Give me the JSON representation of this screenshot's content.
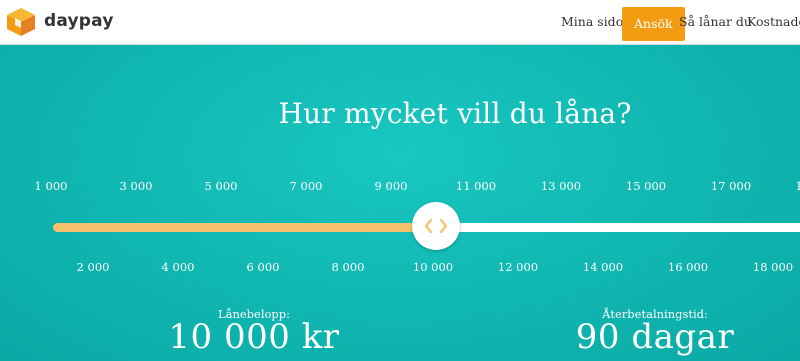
{
  "header": {
    "brand": "daypay",
    "nav": {
      "my_pages": "Mina sidor",
      "apply": "Ansök",
      "how_to_borrow": "Så lånar du",
      "costs": "Kostnader"
    },
    "cta_color": "#f39c12"
  },
  "hero": {
    "title": "Hur mycket vill du låna?",
    "background_color": "#10b6b0"
  },
  "slider": {
    "top_ticks": [
      "1 000",
      "3 000",
      "5 000",
      "7 000",
      "9 000",
      "11 000",
      "13 000",
      "15 000",
      "17 000",
      "1"
    ],
    "bottom_ticks": [
      "2 000",
      "4 000",
      "6 000",
      "8 000",
      "10 000",
      "12 000",
      "14 000",
      "16 000",
      "18 000"
    ],
    "selected_value": 10000,
    "filled_color": "#f5c06c",
    "handle_icon": "left-right-arrows-icon"
  },
  "summary": {
    "amount_label": "Lånebelopp:",
    "amount_value": "10 000 kr",
    "term_label": "Återbetalningstid:",
    "term_value": "90 dagar"
  }
}
